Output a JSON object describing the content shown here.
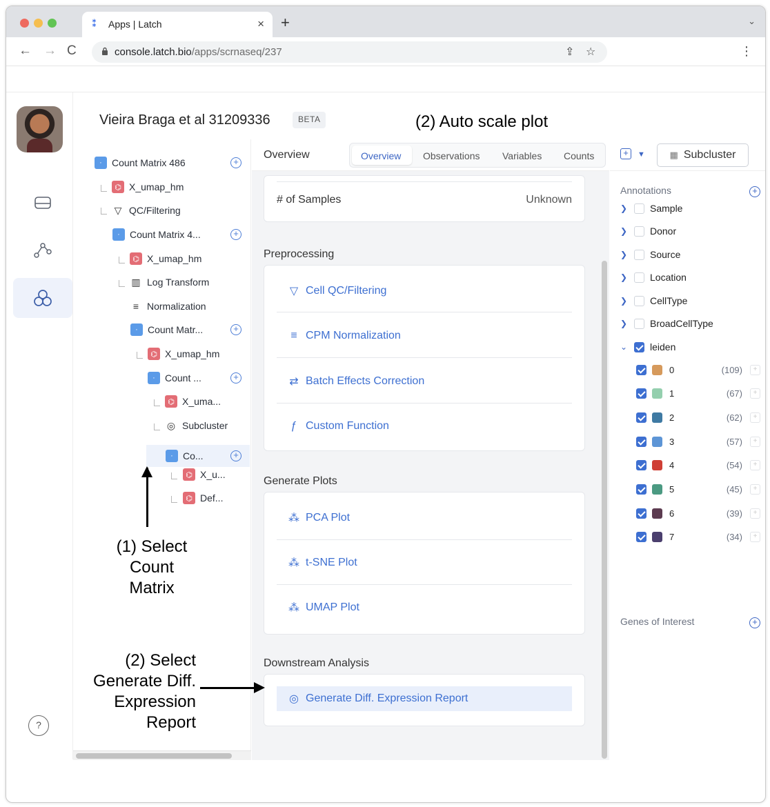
{
  "browser": {
    "tab_title": "Apps | Latch",
    "tab_logo": "⁑",
    "url_host": "console.latch.bio",
    "url_path": "/apps/scrnaseq/237"
  },
  "project": {
    "title": "Vieira Braga et al 31209336",
    "badge": "BETA"
  },
  "tree": {
    "nodes": [
      {
        "label": "Count Matrix 486"
      },
      {
        "label": "X_umap_hm"
      },
      {
        "label": "QC/Filtering"
      },
      {
        "label": "Count Matrix 4..."
      },
      {
        "label": "X_umap_hm"
      },
      {
        "label": "Log Transform"
      },
      {
        "label": "Normalization"
      },
      {
        "label": "Count Matr..."
      },
      {
        "label": "X_umap_hm"
      },
      {
        "label": "Count ..."
      },
      {
        "label": "X_uma..."
      },
      {
        "label": "Subcluster"
      },
      {
        "label": "Co..."
      },
      {
        "label": "X_u..."
      },
      {
        "label": "Def..."
      }
    ]
  },
  "main": {
    "header": "Overview",
    "tabs": [
      "Overview",
      "Observations",
      "Variables",
      "Counts"
    ],
    "samples_label": "# of Samples",
    "samples_value": "Unknown",
    "preprocessing": {
      "title": "Preprocessing",
      "items": [
        "Cell QC/Filtering",
        "CPM Normalization",
        "Batch Effects Correction",
        "Custom Function"
      ]
    },
    "plots": {
      "title": "Generate Plots",
      "items": [
        "PCA Plot",
        "t-SNE Plot",
        "UMAP Plot"
      ]
    },
    "downstream": {
      "title": "Downstream Analysis",
      "items": [
        "Generate Diff. Expression Report"
      ]
    }
  },
  "right": {
    "subcluster_label": "Subcluster",
    "annotations_title": "Annotations",
    "annotations": [
      "Sample",
      "Donor",
      "Source",
      "Location",
      "CellType",
      "BroadCellType",
      "leiden"
    ],
    "leiden": [
      {
        "label": "0",
        "count": "(109)",
        "color": "#d69a5c"
      },
      {
        "label": "1",
        "count": "(67)",
        "color": "#94cfae"
      },
      {
        "label": "2",
        "count": "(62)",
        "color": "#3f7aa3"
      },
      {
        "label": "3",
        "count": "(57)",
        "color": "#5d95d6"
      },
      {
        "label": "4",
        "count": "(54)",
        "color": "#cf3f35"
      },
      {
        "label": "5",
        "count": "(45)",
        "color": "#4b9a82"
      },
      {
        "label": "6",
        "count": "(39)",
        "color": "#5c3b50"
      },
      {
        "label": "7",
        "count": "(34)",
        "color": "#4b3f6e"
      }
    ],
    "genes_title": "Genes of Interest"
  },
  "annotations_overlay": {
    "auto_scale": "(2) Auto scale plot",
    "select_count": [
      "(1) Select",
      "Count",
      "Matrix"
    ],
    "select_generate": [
      "(2) Select",
      "Generate Diff.",
      "Expression",
      "Report"
    ]
  }
}
